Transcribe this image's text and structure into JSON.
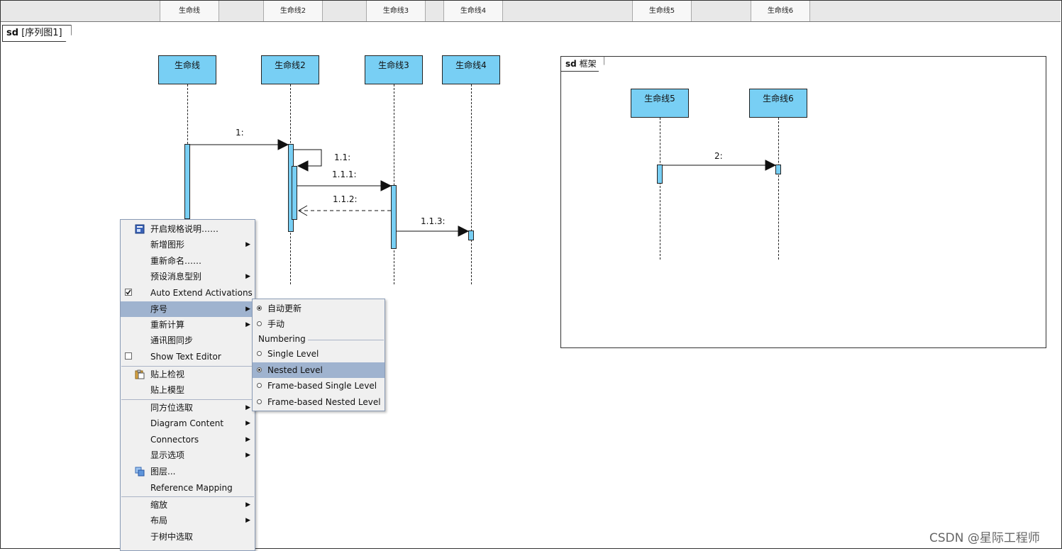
{
  "ruler": {
    "tabs": [
      "生命线",
      "生命线2",
      "生命线3",
      "生命线4",
      "生命线5",
      "生命线6"
    ]
  },
  "diagram": {
    "label_kind": "sd",
    "label_name": "[序列图1]",
    "lifelines": [
      "生命线",
      "生命线2",
      "生命线3",
      "生命线4"
    ],
    "frame": {
      "kind": "sd",
      "name": "框架",
      "lifelines": [
        "生命线5",
        "生命线6"
      ]
    },
    "messages": [
      "1:",
      "1.1:",
      "1.1.1:",
      "1.1.2:",
      "1.1.3:",
      "2:"
    ]
  },
  "context_menu": {
    "items": [
      {
        "label": "开启规格说明……",
        "icon": "spec-icon"
      },
      {
        "label": "新增图形",
        "submenu": true
      },
      {
        "label": "重新命名……"
      },
      {
        "label": "预设消息型别",
        "submenu": true
      },
      {
        "label": "Auto Extend Activations",
        "checked": true
      },
      {
        "label": "序号",
        "submenu": true,
        "highlighted": true
      },
      {
        "label": "重新计算",
        "submenu": true
      },
      {
        "label": "通讯图同步"
      },
      {
        "label": "Show Text Editor",
        "checked": false
      },
      {
        "label": "贴上检视",
        "icon": "paste-icon"
      },
      {
        "label": "贴上模型"
      },
      {
        "label": "同方位选取",
        "submenu": true
      },
      {
        "label": "Diagram Content",
        "submenu": true
      },
      {
        "label": "Connectors",
        "submenu": true
      },
      {
        "label": "显示选项",
        "submenu": true
      },
      {
        "label": "图层...",
        "icon": "layers-icon"
      },
      {
        "label": "Reference Mapping"
      },
      {
        "label": "缩放",
        "submenu": true
      },
      {
        "label": "布局",
        "submenu": true
      },
      {
        "label": "于树中选取"
      }
    ]
  },
  "submenu": {
    "items": [
      {
        "label": "自动更新",
        "selected": true
      },
      {
        "label": "手动",
        "selected": false
      }
    ],
    "group_label": "Numbering",
    "numbering": [
      {
        "label": "Single Level",
        "selected": false
      },
      {
        "label": "Nested Level",
        "selected": true,
        "highlighted": true
      },
      {
        "label": "Frame-based Single Level",
        "selected": false
      },
      {
        "label": "Frame-based Nested Level",
        "selected": false
      }
    ]
  },
  "watermark": "CSDN @星际工程师",
  "colors": {
    "lifeline_fill": "#78cff4",
    "menu_highlight": "#9fb3cf",
    "menu_bg": "#f0f0f0"
  }
}
